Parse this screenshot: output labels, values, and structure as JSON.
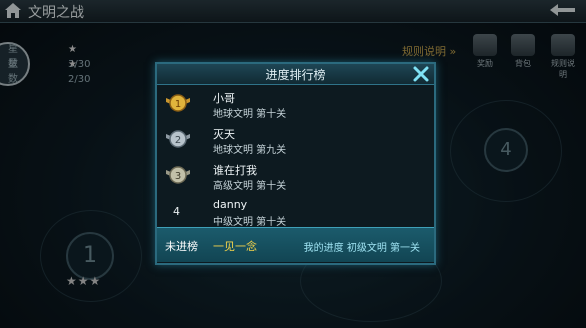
{
  "header": {
    "title": "文明之战"
  },
  "stats": [
    {
      "label": "星数",
      "value": "3/30"
    },
    {
      "label": "星数",
      "value": "2/30"
    }
  ],
  "rules_link": "规则说明 »",
  "side_icons": [
    {
      "label": "奖励"
    },
    {
      "label": "背包"
    },
    {
      "label": "规则说明"
    }
  ],
  "map_nodes": {
    "left": "1",
    "right": "4"
  },
  "leaderboard": {
    "title": "进度排行榜",
    "entries": [
      {
        "rank": "1",
        "name": "小哥",
        "info": "地球文明  第十关",
        "medal": "gold"
      },
      {
        "rank": "2",
        "name": "灭天",
        "info": "地球文明  第九关",
        "medal": "silver"
      },
      {
        "rank": "3",
        "name": "谁在打我",
        "info": "高级文明  第十关",
        "medal": "bronze"
      },
      {
        "rank": "4",
        "name": "danny",
        "info": "中级文明  第十关",
        "medal": "none"
      }
    ],
    "footer": {
      "status": "未进榜",
      "name": "一见一念",
      "progress": "我的进度  初级文明  第一关"
    }
  },
  "colors": {
    "accent": "#2b6a7e",
    "highlight": "#f3d24a",
    "footer": "#1b5b6c"
  }
}
